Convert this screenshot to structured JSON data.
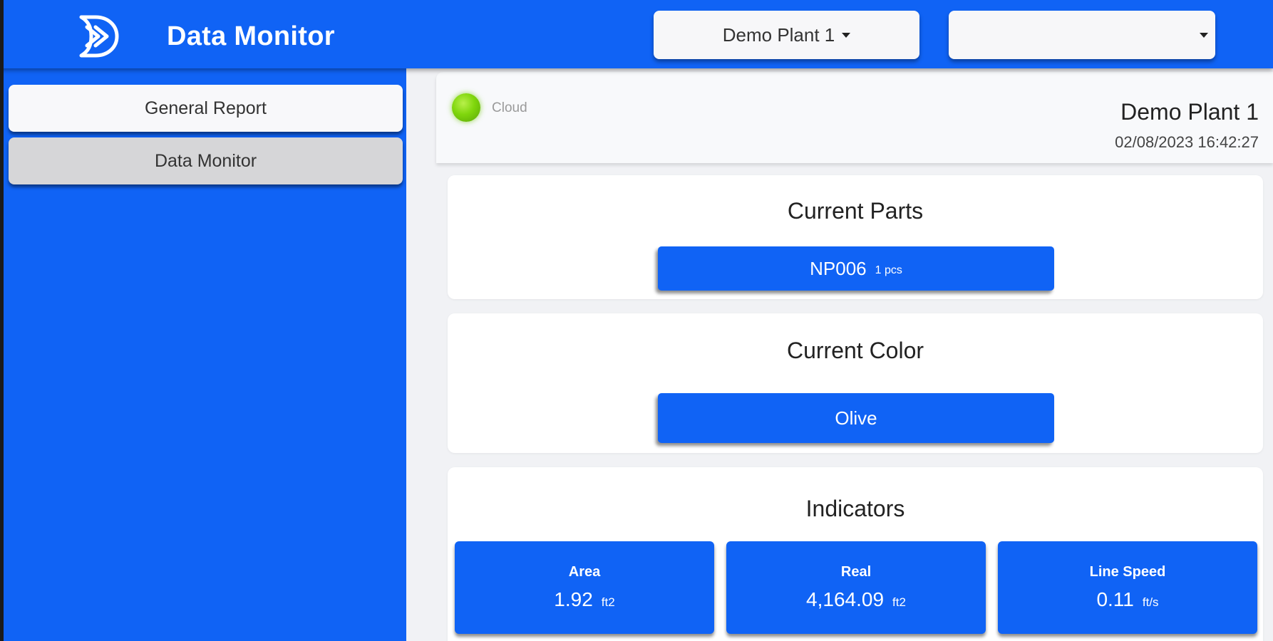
{
  "header": {
    "app_title": "Data Monitor",
    "plant_select": {
      "value": "Demo Plant 1"
    },
    "secondary_select": {
      "value": ""
    }
  },
  "sidebar": {
    "items": [
      {
        "label": "General Report",
        "active": false
      },
      {
        "label": "Data Monitor",
        "active": true
      }
    ]
  },
  "status": {
    "connection_label": "Cloud",
    "connection_state": "online",
    "led_color": "#7fd60c",
    "plant_name": "Demo Plant 1",
    "timestamp": "02/08/2023 16:42:27"
  },
  "current_parts": {
    "title": "Current Parts",
    "part_code": "NP006",
    "quantity": "1 pcs"
  },
  "current_color": {
    "title": "Current Color",
    "value": "Olive"
  },
  "indicators": {
    "title": "Indicators",
    "tiles": [
      {
        "label": "Area",
        "value": "1.92",
        "unit": "ft2"
      },
      {
        "label": "Real",
        "value": "4,164.09",
        "unit": "ft2"
      },
      {
        "label": "Line Speed",
        "value": "0.11",
        "unit": "ft/s"
      }
    ]
  },
  "colors": {
    "primary": "#1063f5",
    "card_bg": "#ffffff",
    "main_bg": "#f1f2f5",
    "nav_active_bg": "#d6d6d8"
  }
}
